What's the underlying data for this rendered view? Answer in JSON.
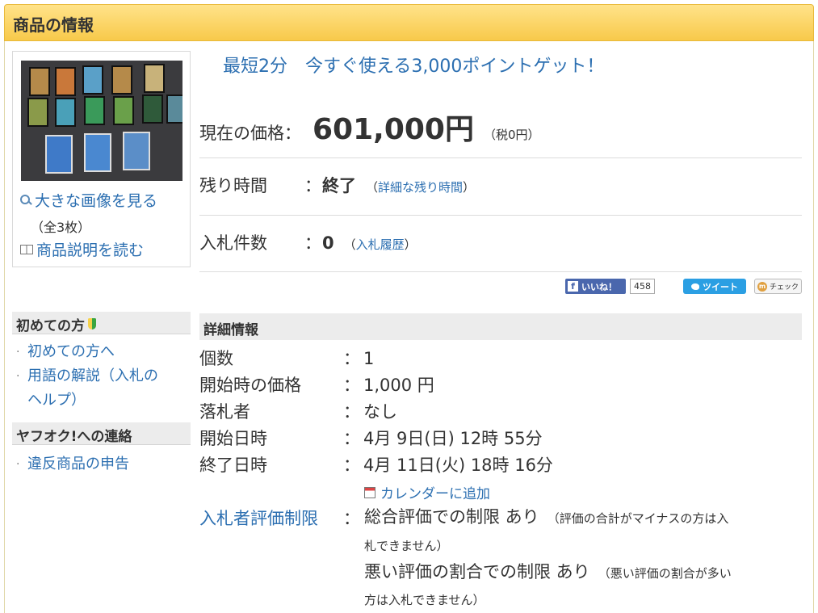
{
  "header": {
    "title": "商品の情報"
  },
  "thumbnail": {
    "large_image_link": "大きな画像を見る",
    "image_count": "（全3枚）",
    "description_link": "商品説明を読む"
  },
  "promo": "最短2分　今すぐ使える3,000ポイントゲット！",
  "price": {
    "label": "現在の価格：",
    "value": "601,000円",
    "tax": "（税0円）"
  },
  "time_left": {
    "label": "残り時間",
    "colon": "：",
    "value": "終了",
    "link": "詳細な残り時間"
  },
  "bids": {
    "label": "入札件数",
    "colon": "：",
    "value": "0",
    "link": "入札履歴"
  },
  "social": {
    "facebook_label": "いいね！",
    "facebook_count": "458",
    "tweet_label": "ツイート",
    "check_label": "チェック"
  },
  "sidebar": {
    "beginner_heading": "初めての方",
    "beginner_links": [
      "初めての方へ",
      "用語の解説（入札の",
      "ヘルプ）"
    ],
    "contact_heading": "ヤフオク!への連絡",
    "contact_links": [
      "違反商品の申告"
    ]
  },
  "details": {
    "heading": "詳細情報",
    "rows": [
      {
        "label": "個数",
        "colon": "：",
        "value": "1"
      },
      {
        "label": "開始時の価格",
        "colon": "：",
        "value": "1,000 円"
      },
      {
        "label": "落札者",
        "colon": "：",
        "value": "なし"
      },
      {
        "label": "開始日時",
        "colon": "：",
        "value": "4月 9日(日) 12時 55分"
      },
      {
        "label": "終了日時",
        "colon": "：",
        "value": "4月 11日(火) 18時 16分"
      }
    ],
    "calendar_link": "カレンダーに追加",
    "restriction": {
      "label": "入札者評価制限",
      "colon": "：",
      "line1_main": "総合評価での制限 あり",
      "line1_sub_a": "（評価の合計がマイナスの方は入",
      "line1_sub_b": "札できません）",
      "line2_main": "悪い評価の割合での制限 あり",
      "line2_sub_a": "（悪い評価の割合が多い",
      "line2_sub_b": "方は入札できません）"
    }
  }
}
